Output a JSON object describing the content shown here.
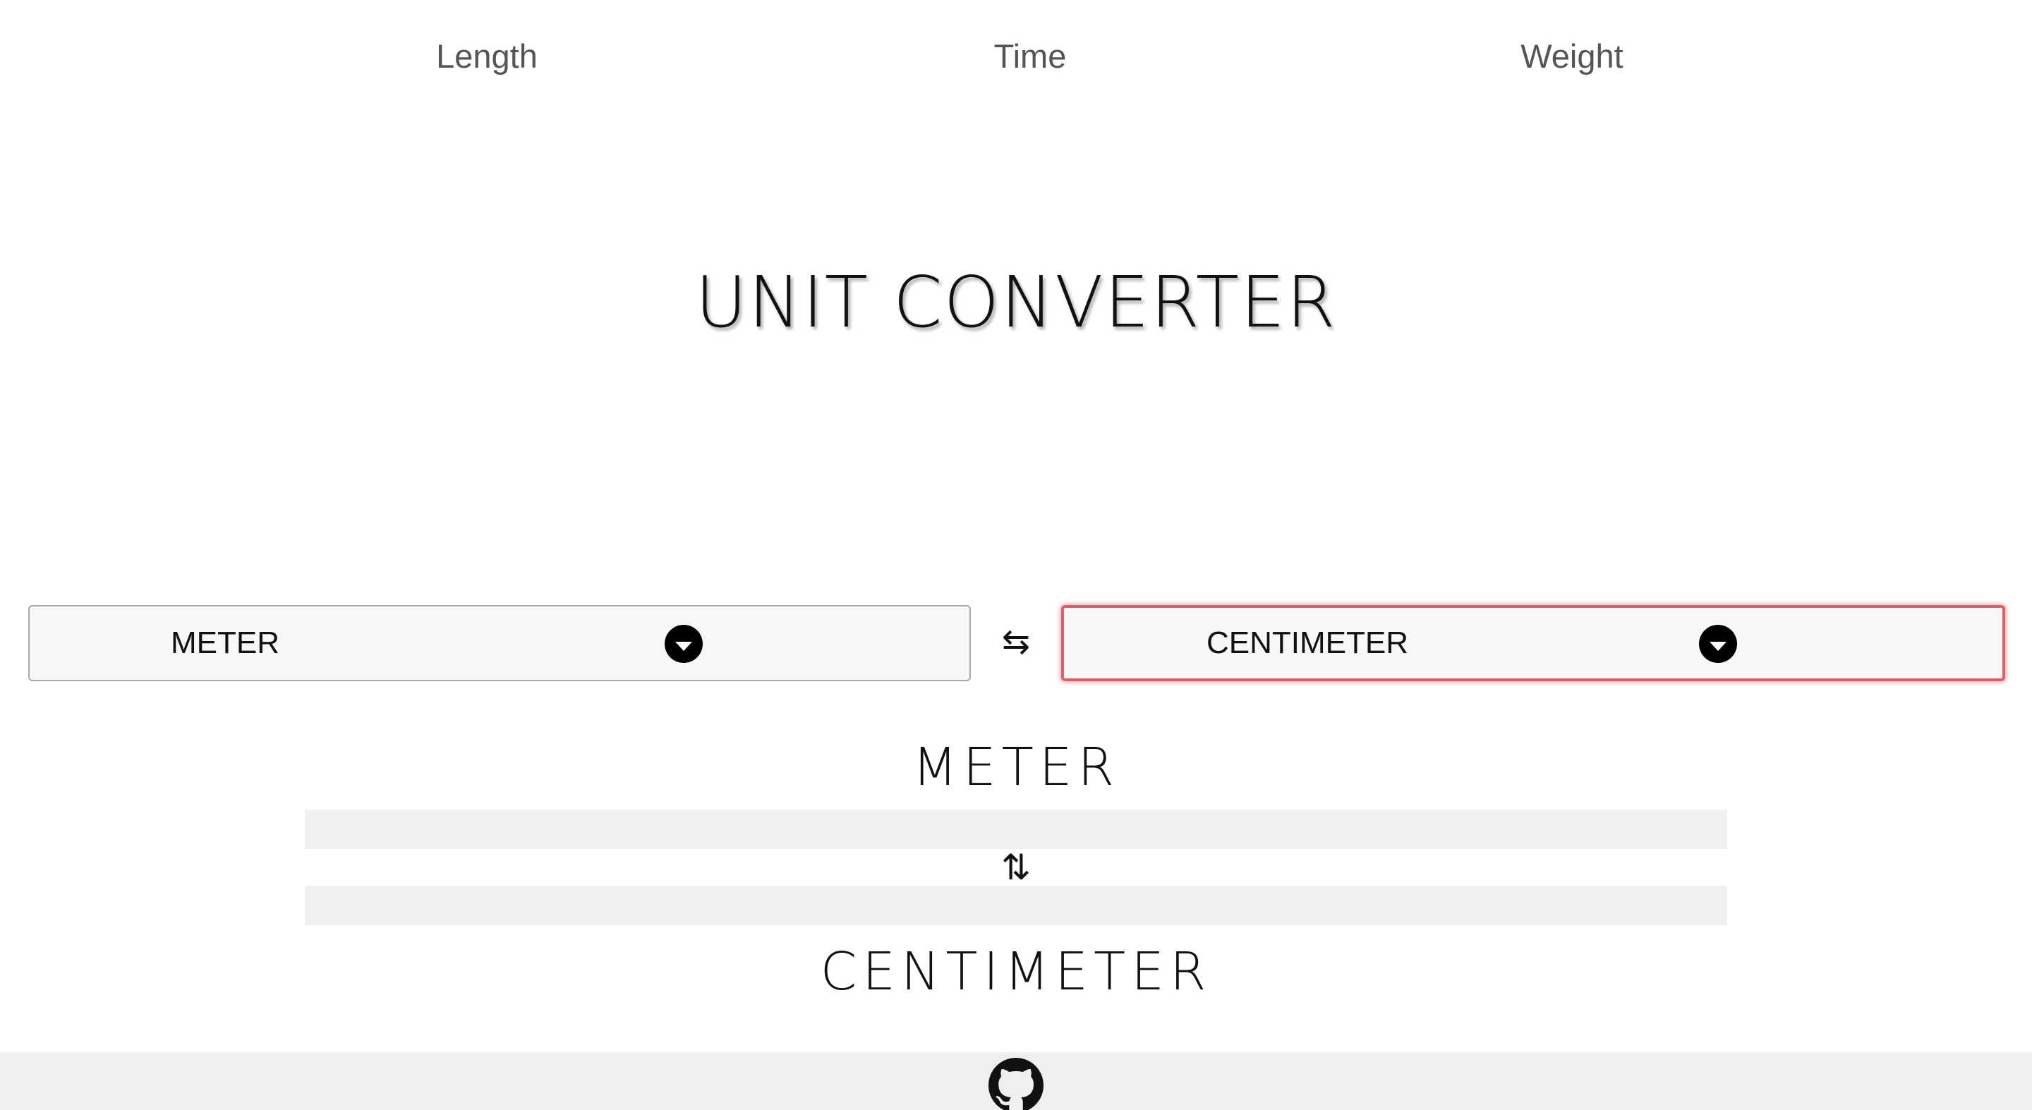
{
  "nav": {
    "items": [
      {
        "label": "Length"
      },
      {
        "label": "Time"
      },
      {
        "label": "Weight"
      }
    ]
  },
  "title": "UNIT CONVERTER",
  "converter": {
    "from_unit": "METER",
    "to_unit": "CENTIMETER",
    "from_value": "",
    "to_value": "",
    "swap_horizontal_icon": "⇆",
    "swap_vertical_icon": "⇅"
  },
  "headings": {
    "from": "METER",
    "to": "CENTIMETER"
  },
  "colors": {
    "focus_border": "#d9626a",
    "input_background": "#efefef",
    "footer_background": "#efefef"
  },
  "footer": {
    "icon": "github-icon"
  }
}
